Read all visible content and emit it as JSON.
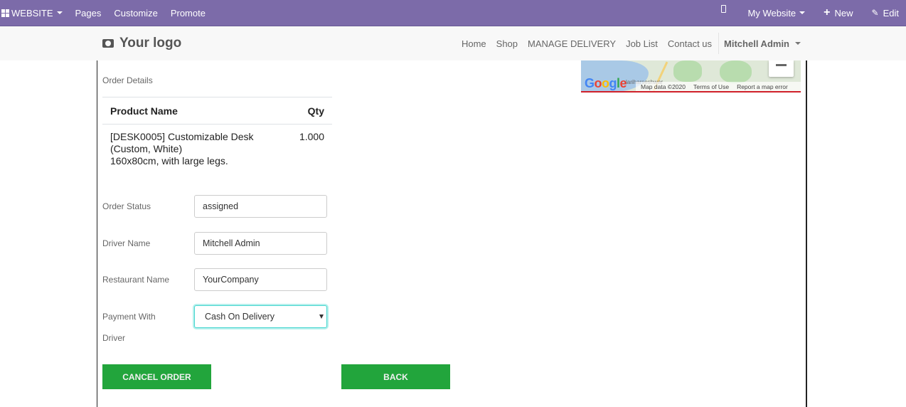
{
  "topbar": {
    "website_menu": "WEBSITE",
    "pages": "Pages",
    "customize": "Customize",
    "promote": "Promote",
    "site_selector": "My Website",
    "new_label": "New",
    "edit_label": "Edit"
  },
  "header": {
    "logo_text": "Your logo",
    "nav": [
      "Home",
      "Shop",
      "MANAGE DELIVERY",
      "Job List",
      "Contact us"
    ],
    "user_menu": "Mitchell Admin"
  },
  "map": {
    "brand": "Google",
    "place_label": "lariharseshwar",
    "map_data": "Map data ©2020",
    "terms": "Terms of Use",
    "report": "Report a map error"
  },
  "order": {
    "section_title": "Order Details",
    "columns": [
      "Product Name",
      "Qty"
    ],
    "rows": [
      {
        "product": "[DESK0005] Customizable Desk (Custom, White) 160x80cm, with large legs.",
        "product_lines": [
          "[DESK0005] Customizable Desk",
          "(Custom, White)",
          "160x80cm, with large legs."
        ],
        "qty": "1.000"
      }
    ]
  },
  "form": {
    "order_status_label": "Order Status",
    "order_status_value": "assigned",
    "driver_name_label": "Driver Name",
    "driver_name_value": "Mitchell Admin",
    "restaurant_name_label": "Restaurant Name",
    "restaurant_name_value": "YourCompany",
    "payment_label": "Payment With",
    "payment_value": "Cash On Delivery",
    "driver_label": "Driver"
  },
  "actions": {
    "cancel_order": "CANCEL ORDER",
    "back": "BACK"
  },
  "colors": {
    "topbar": "#7c6ba9",
    "button_green": "#22a53c",
    "select_focus": "#48d6d0"
  }
}
